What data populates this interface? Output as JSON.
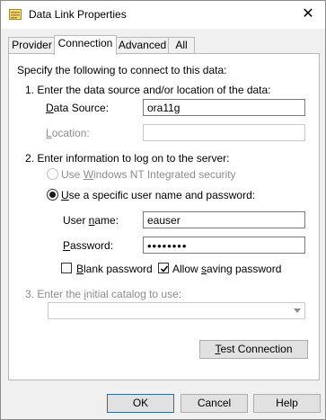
{
  "window": {
    "title": "Data Link Properties",
    "close_symbol": "✕",
    "icon": "data-link-icon"
  },
  "tabs": [
    {
      "label": "Provider",
      "active": false
    },
    {
      "label": "Connection",
      "active": true
    },
    {
      "label": "Advanced",
      "active": false
    },
    {
      "label": "All",
      "active": false
    }
  ],
  "connection": {
    "intro": "Specify the following to connect to this data:",
    "step1": "1. Enter the data source and/or location of the data:",
    "data_source": {
      "label_u": "D",
      "label_rest": "ata Source:",
      "value": "ora11g"
    },
    "location": {
      "label_u": "L",
      "label_rest": "ocation:",
      "value": ""
    },
    "step2": "2. Enter information to log on to the server:",
    "auth_windows": {
      "pre": "Use ",
      "u": "W",
      "post": "indows NT Integrated security",
      "selected": false,
      "enabled": false
    },
    "auth_specific": {
      "u": "U",
      "post": "se a specific user name and password:",
      "selected": true,
      "enabled": true
    },
    "user_name": {
      "pre": "User ",
      "u": "n",
      "post": "ame:",
      "value": "eauser"
    },
    "password": {
      "u": "P",
      "post": "assword:",
      "value": "••••••••"
    },
    "blank_password": {
      "u": "B",
      "post": "lank password",
      "checked": false
    },
    "allow_saving": {
      "pre": "Allow ",
      "u": "s",
      "post": "aving password",
      "checked": true
    },
    "step3": {
      "pre": "3. Enter the ",
      "u": "i",
      "post": "nitial catalog to use:"
    },
    "catalog_value": "",
    "test_connection": {
      "u": "T",
      "post": "est Connection"
    }
  },
  "footer": {
    "ok": "OK",
    "cancel": "Cancel",
    "help": "Help"
  }
}
